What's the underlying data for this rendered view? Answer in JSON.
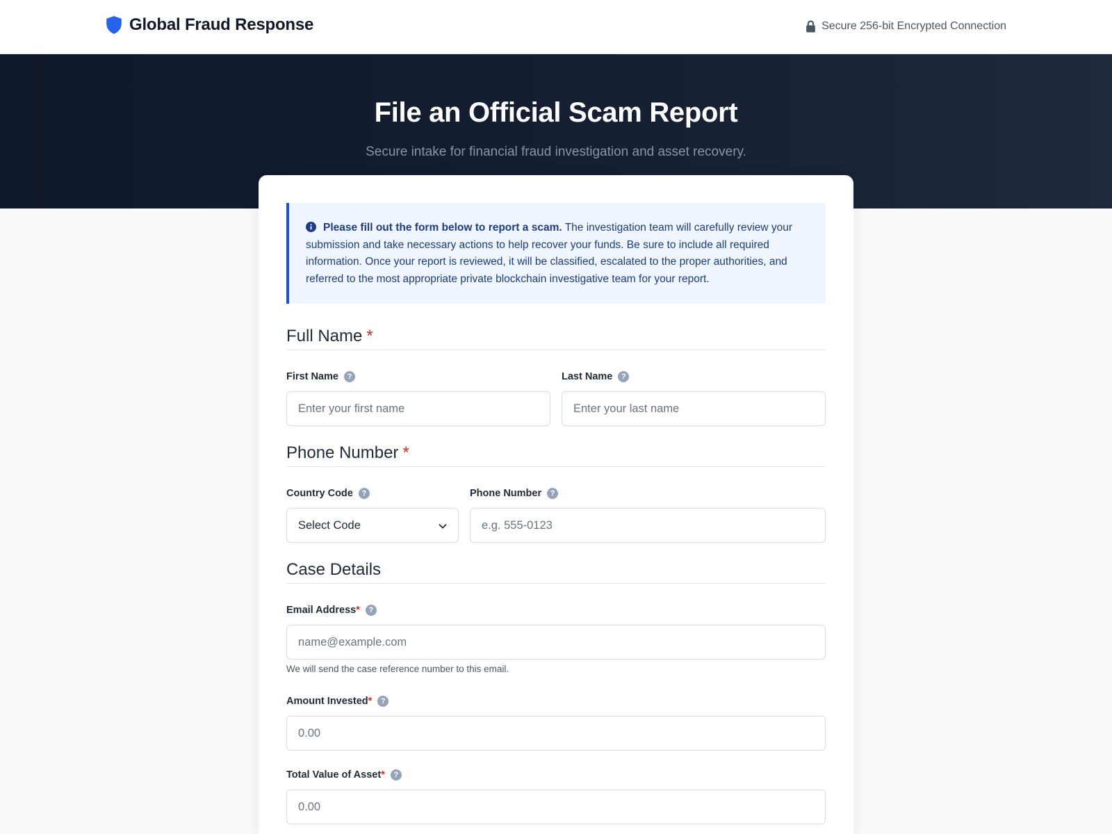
{
  "header": {
    "brand": "Global Fraud Response",
    "secure_text": "Secure 256-bit Encrypted Connection"
  },
  "hero": {
    "title": "File an Official Scam Report",
    "subtitle": "Secure intake for financial fraud investigation and asset recovery."
  },
  "notice": {
    "lead": "Please fill out the form below to report a scam.",
    "body": " The investigation team will carefully review your submission and take necessary actions to help recover your funds. Be sure to include all required information. Once your report is reviewed, it will be classified, escalated to the proper authorities, and referred to the most appropriate private blockchain investigative team for your report."
  },
  "sections": {
    "full_name": "Full Name",
    "phone": "Phone Number",
    "case": "Case Details",
    "required_mark": "*"
  },
  "fields": {
    "first_name": {
      "label": "First Name",
      "placeholder": "Enter your first name"
    },
    "last_name": {
      "label": "Last Name",
      "placeholder": "Enter your last name"
    },
    "country_code": {
      "label": "Country Code",
      "value": "Select Code"
    },
    "phone_number": {
      "label": "Phone Number",
      "placeholder": "e.g. 555-0123"
    },
    "email": {
      "label": "Email Address",
      "placeholder": "name@example.com",
      "hint": "We will send the case reference number to this email."
    },
    "amount_invested": {
      "label": "Amount Invested",
      "placeholder": "0.00"
    },
    "total_value": {
      "label": "Total Value of Asset",
      "placeholder": "0.00"
    }
  },
  "help_glyph": "?",
  "colors": {
    "accent": "#1d4ed8",
    "hero_bg": "#0f172a",
    "notice_bg": "#eff6ff",
    "required": "#dc2626"
  },
  "icons": {
    "brand": "shield-icon",
    "secure": "lock-icon",
    "notice": "info-icon",
    "select": "chevron-down-icon",
    "help": "help-icon"
  }
}
